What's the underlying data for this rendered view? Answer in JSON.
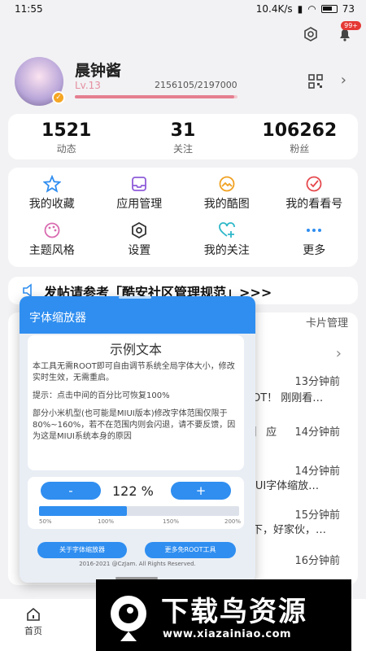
{
  "status_bar": {
    "time": "11:55",
    "network": "10.4K/s",
    "battery": "73"
  },
  "top_icons": {
    "settings_icon": "gear-icon",
    "notification_badge": "99+"
  },
  "profile": {
    "username": "晨钟酱",
    "level": "Lv.13",
    "exp": "2156105/2197000",
    "exp_fraction": 0.981
  },
  "stats": [
    {
      "value": "1521",
      "label": "动态"
    },
    {
      "value": "31",
      "label": "关注"
    },
    {
      "value": "106262",
      "label": "粉丝"
    }
  ],
  "menu": [
    {
      "label": "我的收藏",
      "icon": "star-icon",
      "color": "#2f8ef0"
    },
    {
      "label": "应用管理",
      "icon": "inbox-icon",
      "color": "#8e5cd9"
    },
    {
      "label": "我的酷图",
      "icon": "image-icon",
      "color": "#f0a020"
    },
    {
      "label": "我的看看号",
      "icon": "check-circle-icon",
      "color": "#e5484d"
    },
    {
      "label": "主题风格",
      "icon": "palette-icon",
      "color": "#d96bb0"
    },
    {
      "label": "设置",
      "icon": "gear-icon",
      "color": "#333333"
    },
    {
      "label": "我的关注",
      "icon": "heart-plus-icon",
      "color": "#2fb8c9"
    },
    {
      "label": "更多",
      "icon": "more-dots-icon",
      "color": "#2f8ef0"
    }
  ],
  "notice": "发帖请参考「酷安社区管理规范」>>>",
  "card_manage": "卡片管理",
  "feed": [
    {
      "time": "13分钟前",
      "content": "OT！ 刚刚看…"
    },
    {
      "time": "14分钟前",
      "content": "】 应"
    },
    {
      "time": "14分钟前",
      "content": "IUI字体缩放…"
    },
    {
      "time": "15分钟前",
      "content": "下，好家伙，…"
    },
    {
      "time": "16分钟前",
      "content": ""
    }
  ],
  "popup": {
    "title": "字体缩放器",
    "sample_title": "示例文本",
    "paragraphs": [
      "本工具无需ROOT即可自由调节系统全局字体大小，修改实时生效，无需重启。",
      "提示：点击中间的百分比可恢复100%",
      "部分小米机型(也可能是MIUI版本)修改字体范围仅限于80%~160%，若不在范围内则会闪退，请不要反馈，因为这是MIUI系统本身的原因"
    ],
    "minus": "-",
    "plus": "+",
    "percent": "122 %",
    "slider_fraction": 0.44,
    "ticks": [
      "50%",
      "100%",
      "150%",
      "200%"
    ],
    "about_button": "关于字体缩放器",
    "more_button": "更多免ROOT工具",
    "copyright": "2016-2021 @CzJam. All Rights Reserved."
  },
  "bottom_nav": {
    "home": "首页"
  },
  "watermark": {
    "title": "下载鸟资源",
    "url": "www.xiazainiao.com"
  }
}
